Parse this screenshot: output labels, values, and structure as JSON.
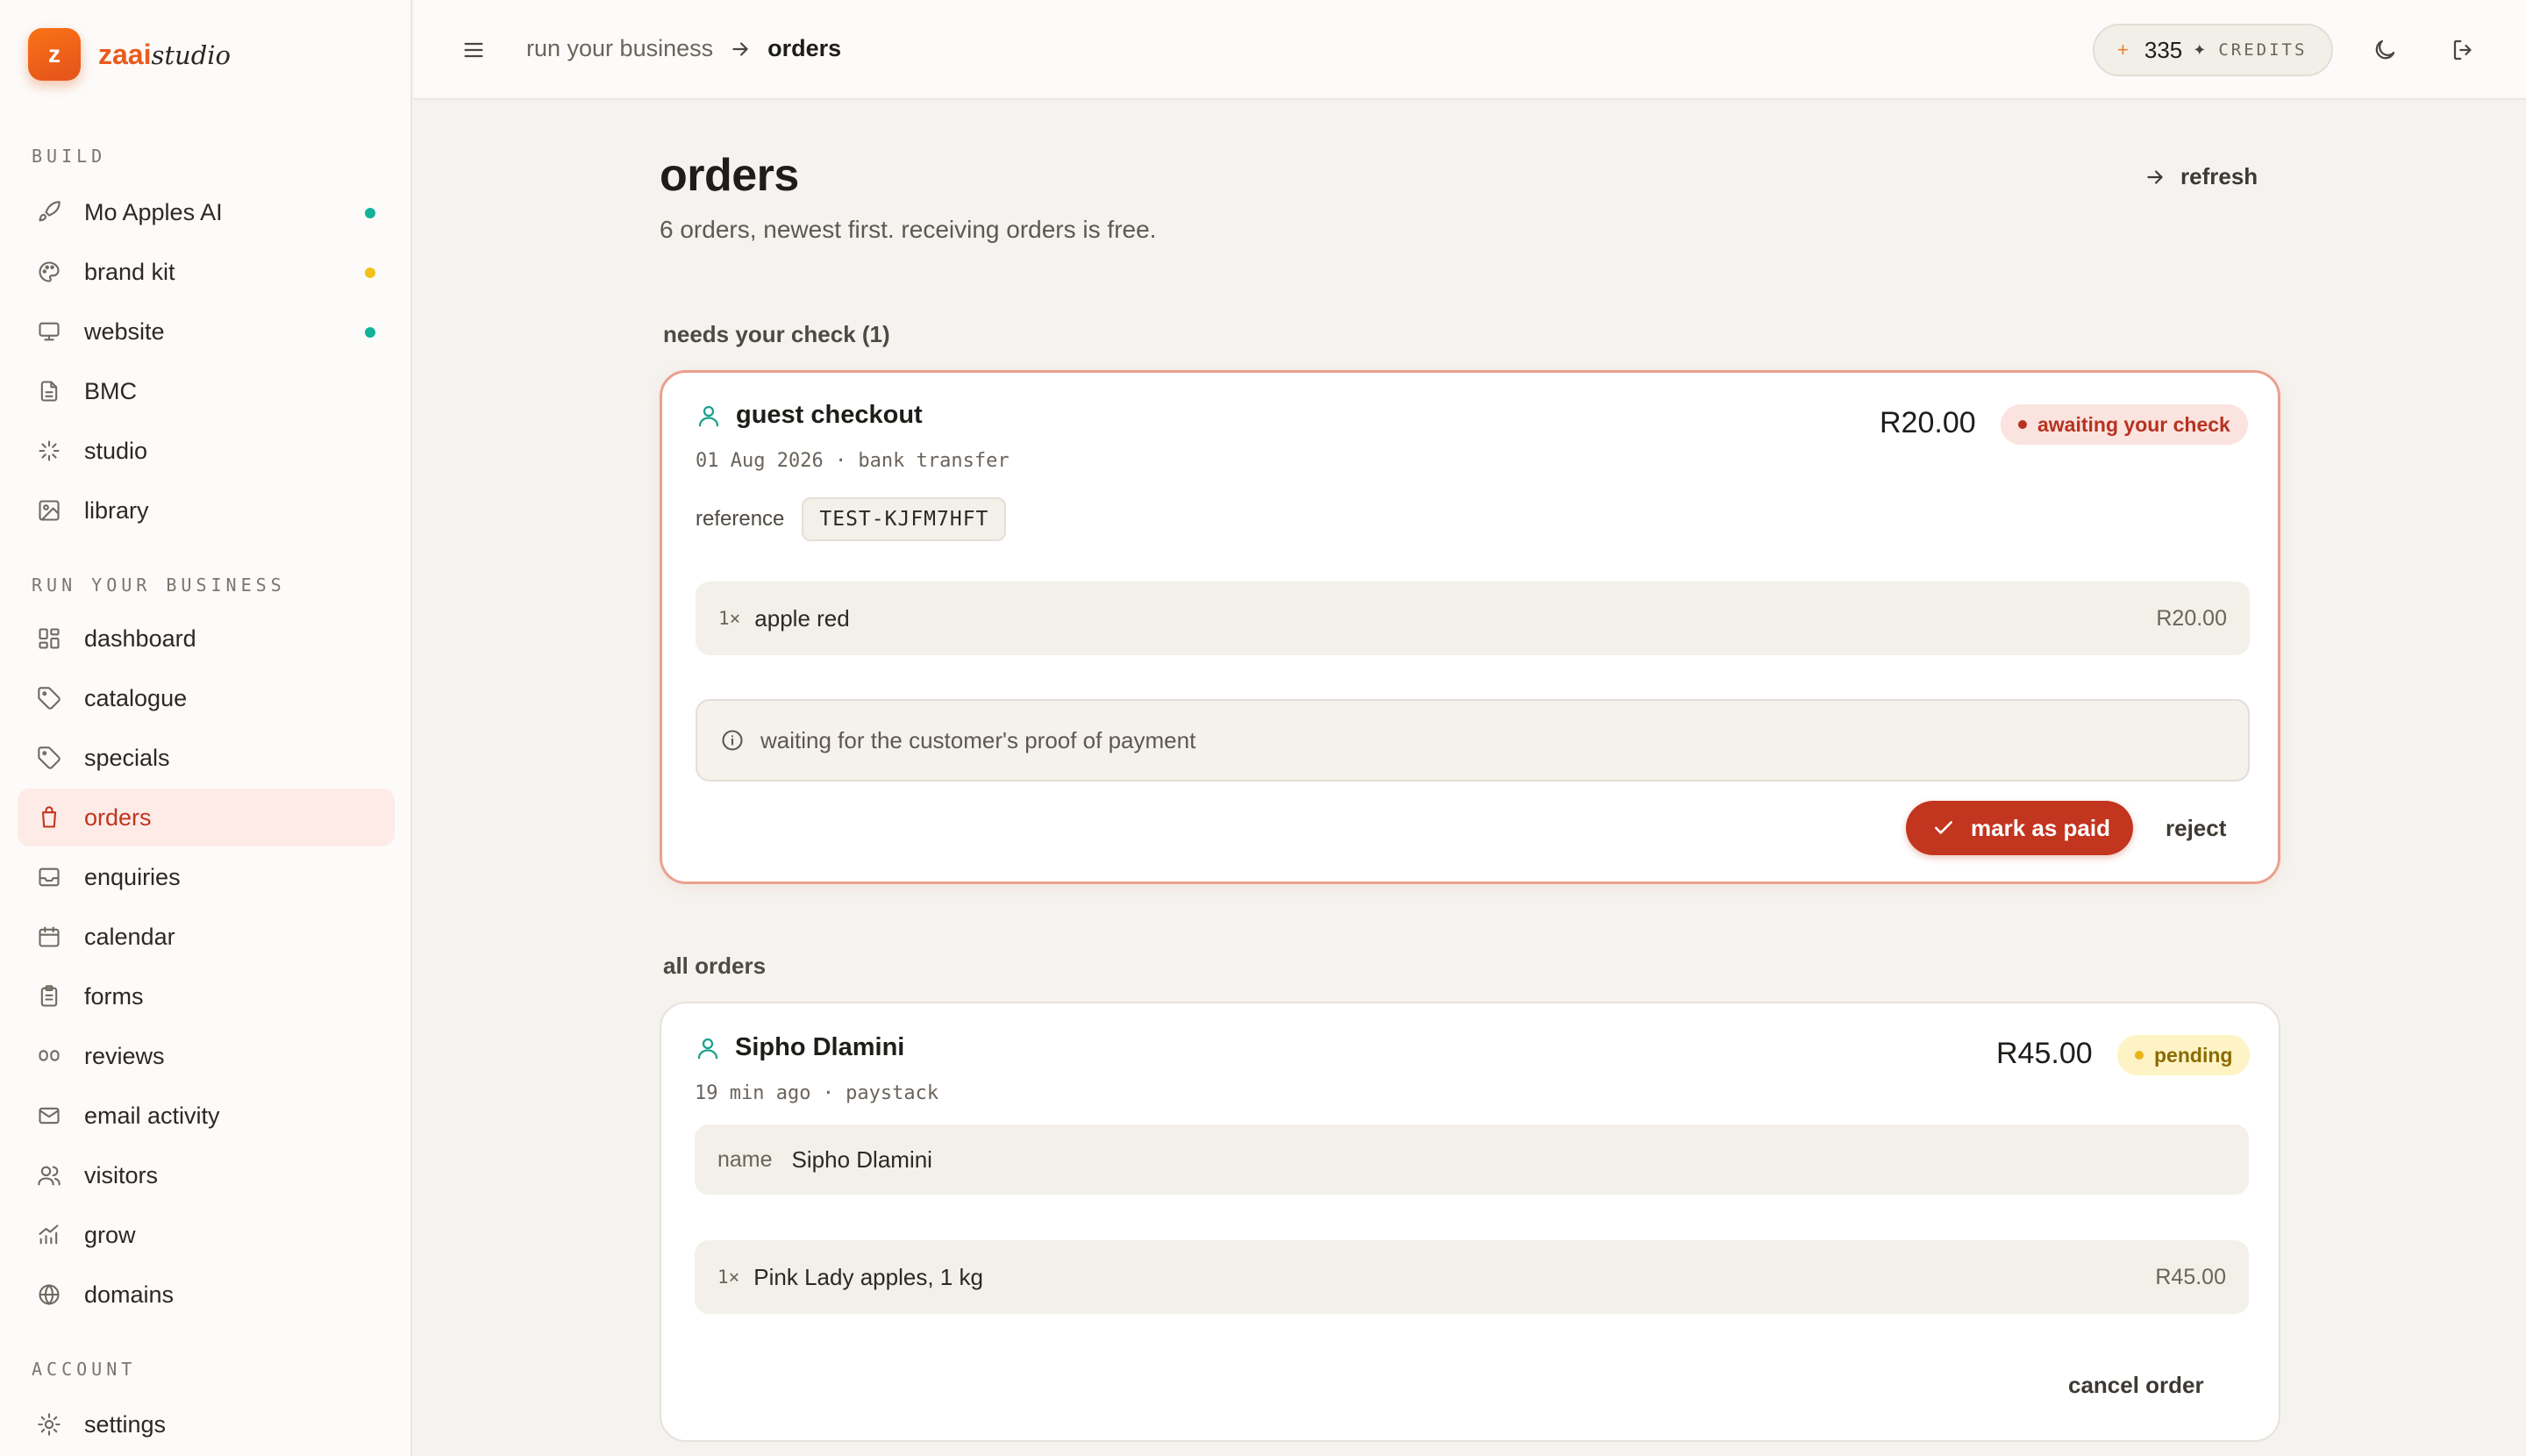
{
  "brand": {
    "badge": "z",
    "name_a": "zaai",
    "name_b": "studio"
  },
  "sidebar": {
    "sections": [
      {
        "label": "BUILD",
        "items": [
          {
            "label": "Mo Apples AI",
            "icon": "rocket-icon",
            "dot": "#14b29a"
          },
          {
            "label": "brand kit",
            "icon": "palette-icon",
            "dot": "#f2c21b"
          },
          {
            "label": "website",
            "icon": "monitor-icon",
            "dot": "#14b29a"
          },
          {
            "label": "BMC",
            "icon": "document-icon"
          },
          {
            "label": "studio",
            "icon": "sparkle-icon"
          },
          {
            "label": "library",
            "icon": "image-icon"
          }
        ]
      },
      {
        "label": "RUN YOUR BUSINESS",
        "items": [
          {
            "label": "dashboard",
            "icon": "grid-icon"
          },
          {
            "label": "catalogue",
            "icon": "tag-icon"
          },
          {
            "label": "specials",
            "icon": "tag-icon"
          },
          {
            "label": "orders",
            "icon": "bag-icon",
            "active": true
          },
          {
            "label": "enquiries",
            "icon": "inbox-icon"
          },
          {
            "label": "calendar",
            "icon": "calendar-icon"
          },
          {
            "label": "forms",
            "icon": "clipboard-icon"
          },
          {
            "label": "reviews",
            "icon": "quote-icon"
          },
          {
            "label": "email activity",
            "icon": "mail-icon"
          },
          {
            "label": "visitors",
            "icon": "users-icon"
          },
          {
            "label": "grow",
            "icon": "chart-icon"
          },
          {
            "label": "domains",
            "icon": "globe-icon"
          }
        ]
      },
      {
        "label": "ACCOUNT",
        "items": [
          {
            "label": "settings",
            "icon": "gear-icon"
          }
        ]
      }
    ]
  },
  "topbar": {
    "breadcrumb": [
      "run your business",
      "orders"
    ],
    "credits": {
      "spark": "+",
      "value": "335",
      "sep": "✦",
      "unit": "CREDITS"
    }
  },
  "page": {
    "title": "orders",
    "subtitle": "6 orders, newest first. receiving orders is free.",
    "refresh_label": "refresh"
  },
  "needs_check": {
    "label": "needs your check (1)",
    "order": {
      "customer": "guest checkout",
      "meta": "01 Aug 2026 · bank transfer",
      "amount": "R20.00",
      "status": "awaiting your check",
      "reference_label": "reference",
      "reference_value": "TEST-KJFM7HFT",
      "item": {
        "qty": "1×",
        "name": "apple red",
        "price": "R20.00"
      },
      "note": "waiting for the customer's proof of payment",
      "mark_paid_label": "mark as paid",
      "reject_label": "reject"
    }
  },
  "all_orders": {
    "label": "all orders",
    "order": {
      "customer": "Sipho Dlamini",
      "meta": "19 min ago · paystack",
      "amount": "R45.00",
      "status": "pending",
      "name_label": "name",
      "name_value": "Sipho Dlamini",
      "item": {
        "qty": "1×",
        "name": "Pink Lady apples, 1 kg",
        "price": "R45.00"
      },
      "cancel_label": "cancel order"
    }
  },
  "colors": {
    "accent": "#c2351f",
    "brand": "#ea5a1d",
    "teal": "#14b29a"
  }
}
